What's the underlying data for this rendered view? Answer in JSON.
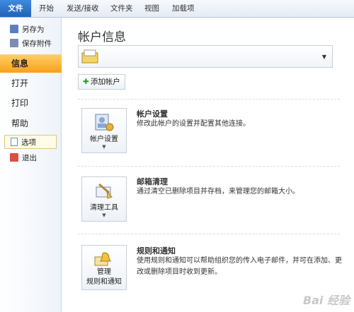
{
  "tabs": [
    "文件",
    "开始",
    "发送/接收",
    "文件夹",
    "视图",
    "加载项"
  ],
  "nav": {
    "save_as": "另存为",
    "save_attachments": "保存附件",
    "info": "信息",
    "open": "打开",
    "print": "打印",
    "help": "帮助",
    "options": "选项",
    "exit": "退出"
  },
  "main": {
    "title": "帐户信息",
    "add_account": "添加帐户",
    "sections": [
      {
        "button_label": "帐户设置",
        "title": "帐户设置",
        "desc": "修改此帐户的设置并配置其他连接。"
      },
      {
        "button_label": "清理工具",
        "title": "邮箱清理",
        "desc": "通过清空已删除项目并存档，来管理您的邮箱大小。"
      },
      {
        "button_label_1": "管理",
        "button_label_2": "规则和通知",
        "title": "规则和通知",
        "desc": "使用规则和通知可以帮助组织您的传入电子邮件，并可在添加、更改或删除项目时收到更新。"
      }
    ]
  },
  "watermark": "Bai 经验"
}
